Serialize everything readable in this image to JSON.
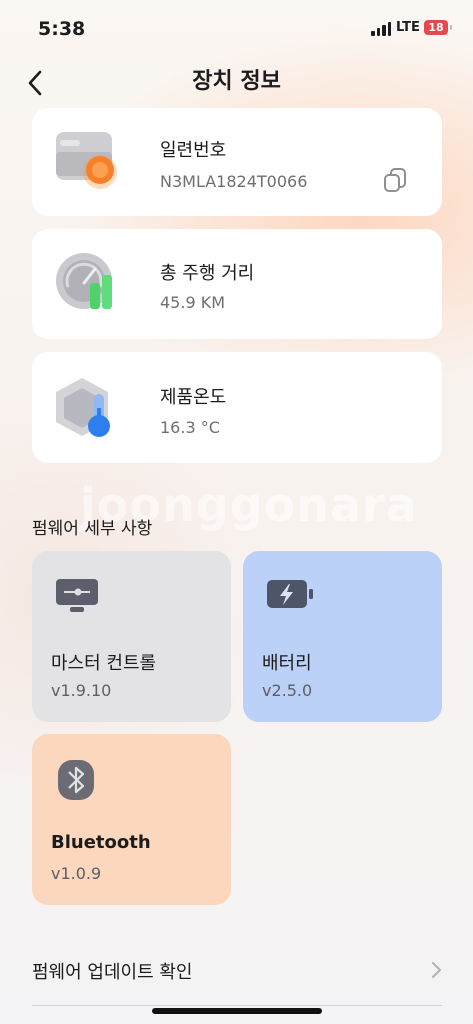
{
  "status_bar": {
    "time": "5:38",
    "network": "LTE",
    "battery": "18"
  },
  "header": {
    "title": "장치 정보"
  },
  "cards": [
    {
      "label": "일련번호",
      "value": "N3MLA1824T0066"
    },
    {
      "label": "총 주행 거리",
      "value": "45.9 KM"
    },
    {
      "label": "제품온도",
      "value": "16.3 °C"
    }
  ],
  "firmware": {
    "section_title": "펌웨어 세부 사항",
    "tiles": [
      {
        "name": "마스터 컨트롤",
        "version": "v1.9.10",
        "color": "#e3e3e6"
      },
      {
        "name": "배터리",
        "version": "v2.5.0",
        "color": "#bcd1f7"
      },
      {
        "name": "Bluetooth",
        "version": "v1.0.9",
        "color": "#fbd8bd"
      }
    ],
    "update_label": "펌웨어 업데이트 확인"
  },
  "watermark": "joonggonara",
  "icons": [
    "back-icon",
    "serial-card-icon",
    "copy-icon",
    "speedometer-icon",
    "thermometer-icon",
    "controller-icon",
    "battery-charge-icon",
    "bluetooth-icon",
    "chevron-right-icon"
  ]
}
